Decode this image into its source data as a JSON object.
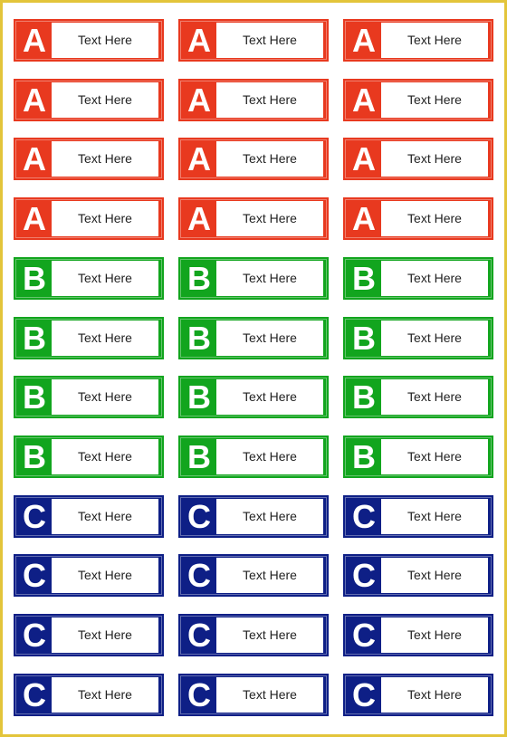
{
  "colors": {
    "A": "#e8391f",
    "B": "#12a51e",
    "C": "#0e1f86",
    "border": "#e3c53a"
  },
  "rows": [
    {
      "letter": "A",
      "labels": [
        "Text Here",
        "Text Here",
        "Text Here"
      ]
    },
    {
      "letter": "A",
      "labels": [
        "Text Here",
        "Text Here",
        "Text Here"
      ]
    },
    {
      "letter": "A",
      "labels": [
        "Text Here",
        "Text Here",
        "Text Here"
      ]
    },
    {
      "letter": "A",
      "labels": [
        "Text Here",
        "Text Here",
        "Text Here"
      ]
    },
    {
      "letter": "B",
      "labels": [
        "Text Here",
        "Text Here",
        "Text Here"
      ]
    },
    {
      "letter": "B",
      "labels": [
        "Text Here",
        "Text Here",
        "Text Here"
      ]
    },
    {
      "letter": "B",
      "labels": [
        "Text Here",
        "Text Here",
        "Text Here"
      ]
    },
    {
      "letter": "B",
      "labels": [
        "Text Here",
        "Text Here",
        "Text Here"
      ]
    },
    {
      "letter": "C",
      "labels": [
        "Text Here",
        "Text Here",
        "Text Here"
      ]
    },
    {
      "letter": "C",
      "labels": [
        "Text Here",
        "Text Here",
        "Text Here"
      ]
    },
    {
      "letter": "C",
      "labels": [
        "Text Here",
        "Text Here",
        "Text Here"
      ]
    },
    {
      "letter": "C",
      "labels": [
        "Text Here",
        "Text Here",
        "Text Here"
      ]
    }
  ]
}
